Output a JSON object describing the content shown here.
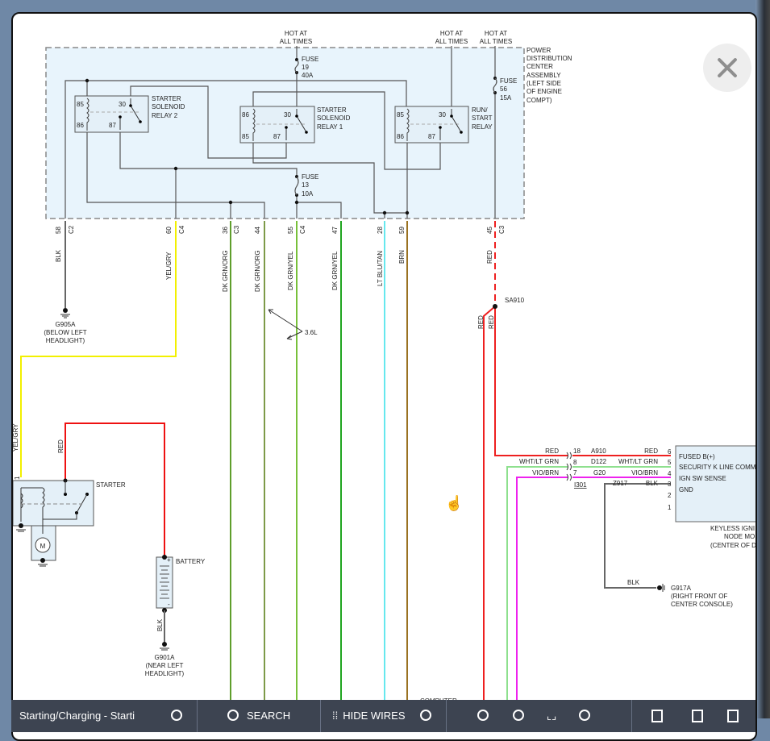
{
  "diagram": {
    "hot_at": [
      "HOT AT",
      "ALL TIMES"
    ],
    "pdc_label": [
      "POWER",
      "DISTRIBUTION",
      "CENTER",
      "ASSEMBLY",
      "(LEFT SIDE",
      "OF ENGINE",
      "COMPT)"
    ],
    "fuse19": [
      "FUSE",
      "19",
      "40A"
    ],
    "fuse56": [
      "FUSE",
      "56",
      "15A"
    ],
    "fuse13": [
      "FUSE",
      "13",
      "10A"
    ],
    "relay2": {
      "label": [
        "STARTER",
        "SOLENOID",
        "RELAY 2"
      ],
      "pins": [
        "85",
        "30",
        "86",
        "87"
      ]
    },
    "relay1": {
      "label": [
        "STARTER",
        "SOLENOID",
        "RELAY 1"
      ],
      "pins": [
        "86",
        "30",
        "85",
        "87"
      ]
    },
    "run_start": {
      "label": [
        "RUN/",
        "START",
        "RELAY"
      ],
      "pins": [
        "85",
        "30",
        "86",
        "87"
      ]
    },
    "wires": [
      {
        "pin": "58",
        "conn": "C2",
        "color_name": "BLK",
        "color": "#666666"
      },
      {
        "pin": "60",
        "conn": "C4",
        "color_name": "YEL/GRY",
        "color": "#f2f000"
      },
      {
        "pin": "36",
        "conn": "C3",
        "color_name": "DK GRN/ORG",
        "color": "#5f9e2c"
      },
      {
        "pin": "44",
        "conn": "",
        "color_name": "DK GRN/ORG",
        "color": "#7d9a48"
      },
      {
        "pin": "55",
        "conn": "C4",
        "color_name": "DK GRN/YEL",
        "color": "#78c03a"
      },
      {
        "pin": "47",
        "conn": "",
        "color_name": "DK GRN/YEL",
        "color": "#1fa51f"
      },
      {
        "pin": "28",
        "conn": "",
        "color_name": "LT BLU/TAN",
        "color": "#66e8ee"
      },
      {
        "pin": "59",
        "conn": "",
        "color_name": "BRN",
        "color": "#9a7222"
      },
      {
        "pin": "45",
        "conn": "C3",
        "color_name": "RED",
        "color": "#ee2020"
      }
    ],
    "ground_g905a": [
      "G905A",
      "(BELOW LEFT",
      "HEADLIGHT)"
    ],
    "variant_label": "3.6L",
    "splice": "SA910",
    "red_labels": [
      "RED",
      "RED"
    ],
    "starter": {
      "label": "STARTER",
      "pin": "1",
      "wire_in": "YEL/GRY",
      "wire_red": "RED",
      "motor": "M"
    },
    "battery": {
      "label": "BATTERY",
      "plus": "+",
      "minus": "-",
      "wire": "BLK"
    },
    "ground_g901a": [
      "G901A",
      "(NEAR LEFT",
      "HEADLIGHT)"
    ],
    "connector_i301": {
      "name": "I301",
      "rows": [
        {
          "left": "RED",
          "pin": "18",
          "circuit": "A910",
          "right": "RED",
          "module_pin": "6",
          "function": "FUSED B(+)"
        },
        {
          "left": "WHT/LT GRN",
          "pin": "8",
          "circuit": "D122",
          "right": "WHT/LT GRN",
          "module_pin": "5",
          "function": "SECURITY K LINE COMM"
        },
        {
          "left": "VIO/BRN",
          "pin": "7",
          "circuit": "G20",
          "right": "VIO/BRN",
          "module_pin": "4",
          "function": "IGN SW SENSE"
        }
      ]
    },
    "gnd_row": {
      "circuit": "Z917",
      "right": "BLK",
      "module_pin": "3",
      "function": "GND"
    },
    "module_extra_pins": [
      "2",
      "1"
    ],
    "module_label": [
      "KEYLESS IGNI",
      "NODE MO",
      "(CENTER OF D"
    ],
    "ground_g917a": {
      "wire": "BLK",
      "label": [
        "G917A",
        "(RIGHT FRONT OF",
        "CENTER CONSOLE)"
      ]
    },
    "computer_label": "COMPUTER"
  },
  "toolbar": {
    "title": "Starting/Charging - Starti",
    "search": "SEARCH",
    "hide_wires": "HIDE WIRES"
  }
}
